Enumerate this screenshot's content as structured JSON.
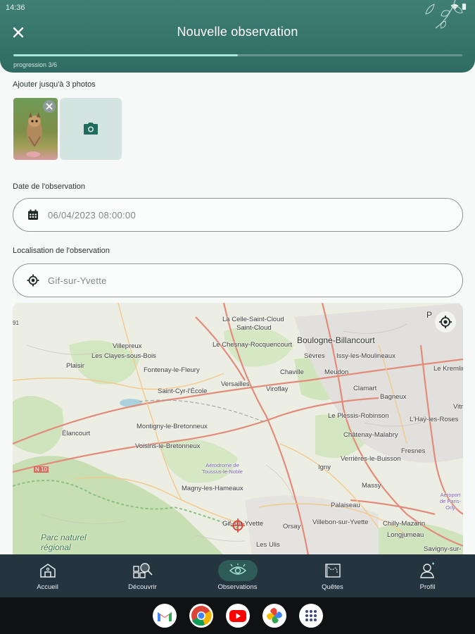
{
  "status_bar": {
    "time": "14:36"
  },
  "header": {
    "title": "Nouvelle observation",
    "progress_label": "progression 3/6",
    "progress_fraction": 0.5
  },
  "photos": {
    "label": "Ajouter jusqu'à 3 photos",
    "icons": {
      "remove": "close-icon",
      "add": "camera-icon"
    }
  },
  "date": {
    "label": "Date de l'observation",
    "value": "06/04/2023 08:00:00",
    "icon": "calendar-icon"
  },
  "location": {
    "label": "Localisation de l'observation",
    "value": "Gif-sur-Yvette",
    "icon": "crosshair-icon"
  },
  "map": {
    "places": [
      "La Celle-Saint-Cloud",
      "Saint-Cloud",
      "Boulogne-Billancourt",
      "Villepreux",
      "Le Chesnay-Rocquencourt",
      "Sèvres",
      "Issy-les-Moulineaux",
      "Les Clayes-sous-Bois",
      "Plaisir",
      "Fontenay-le-Fleury",
      "Versailles",
      "Chaville",
      "Meudon",
      "Le Kremlin-Bicêtre",
      "Saint-Cyr-l'École",
      "Viroflay",
      "Clamart",
      "Bagneux",
      "Élancourt",
      "Montigny-le-Bretonneux",
      "Le Plessis-Robinson",
      "L'Haÿ-les-Roses",
      "Voisins-le-Bretonneux",
      "Châtenay-Malabry",
      "Fresnes",
      "Aérodrome de Toussus-le-Noble",
      "Verrières-le-Buisson",
      "Magny-les-Hameaux",
      "Igny",
      "Massy",
      "Palaiseau",
      "Gif-sur-Yvette",
      "Villebon-sur-Yvette",
      "Orsay",
      "Chilly-Mazarin",
      "Longjumeau",
      "Les Ulis",
      "Savigny-sur-",
      "Parc naturel régional",
      "N 10",
      "Aéroport de Paris-Orly",
      "Vitr",
      "P",
      "91"
    ],
    "locate_icon": "my-location-icon",
    "marker_icon": "target-marker-icon"
  },
  "bottom_nav": {
    "items": [
      {
        "label": "Accueil",
        "icon": "home-icon",
        "active": false
      },
      {
        "label": "Découvrir",
        "icon": "discover-icon",
        "active": false
      },
      {
        "label": "Observations",
        "icon": "eye-icon",
        "active": true
      },
      {
        "label": "Quêtes",
        "icon": "quest-map-icon",
        "active": false
      },
      {
        "label": "Profil",
        "icon": "profile-icon",
        "active": false
      }
    ]
  },
  "dock": {
    "apps": [
      "gmail-icon",
      "chrome-icon",
      "youtube-icon",
      "photos-icon",
      "app-drawer-icon"
    ]
  },
  "colors": {
    "header_bg": "#35756a",
    "progress_fill": "#a7e5d8",
    "nav_bg": "#243540",
    "accent": "#1f6b5d"
  }
}
